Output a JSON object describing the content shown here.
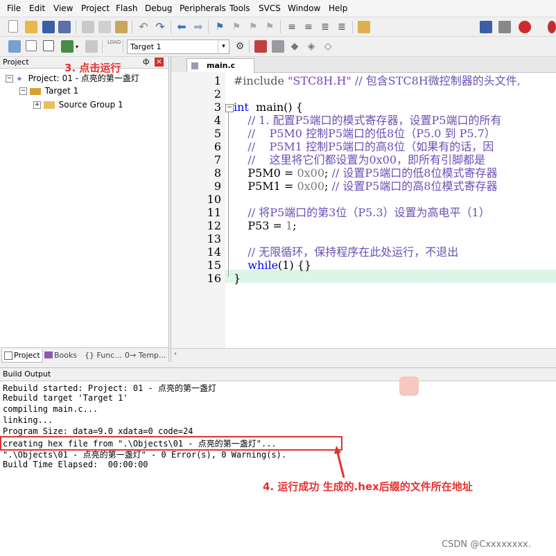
{
  "menu": [
    "File",
    "Edit",
    "View",
    "Project",
    "Flash",
    "Debug",
    "Peripherals",
    "Tools",
    "SVCS",
    "Window",
    "Help"
  ],
  "toolbar": {
    "target_select": "Target 1"
  },
  "project_panel": {
    "title": "Project",
    "pin": "ф",
    "close": "×",
    "root": "Project: 01 - 点亮的第一盏灯",
    "target": "Target 1",
    "group": "Source Group 1",
    "tabs": [
      "Project",
      "Books",
      "{} Func...",
      "0→ Temp..."
    ]
  },
  "annotations": {
    "run": "3. 点击运行",
    "output": "4. 运行成功 生成的.hex后缀的文件所在地址"
  },
  "editor": {
    "tab": "main.c",
    "line_numbers": [
      "1",
      "2",
      "3",
      "4",
      "5",
      "6",
      "7",
      "8",
      "9",
      "10",
      "11",
      "12",
      "13",
      "14",
      "15",
      "16"
    ]
  },
  "build": {
    "title": "Build Output",
    "lines": [
      "Rebuild started: Project: 01 - 点亮的第一盏灯",
      "Rebuild target 'Target 1'",
      "compiling main.c...",
      "linking...",
      "Program Size: data=9.0 xdata=0 code=24",
      "creating hex file from \".\\Objects\\01 - 点亮的第一盏灯\"...",
      "\".\\Objects\\01 - 点亮的第一盏灯\" - 0 Error(s), 0 Warning(s).",
      "Build Time Elapsed:  00:00:00"
    ]
  },
  "watermark": "CSDN @Cxxxxxxxx.",
  "colors": {
    "annotation": "#e53030",
    "keyword": "#0000ff",
    "comment": "#6a4fb5",
    "active_line": "#dcf5e6"
  }
}
